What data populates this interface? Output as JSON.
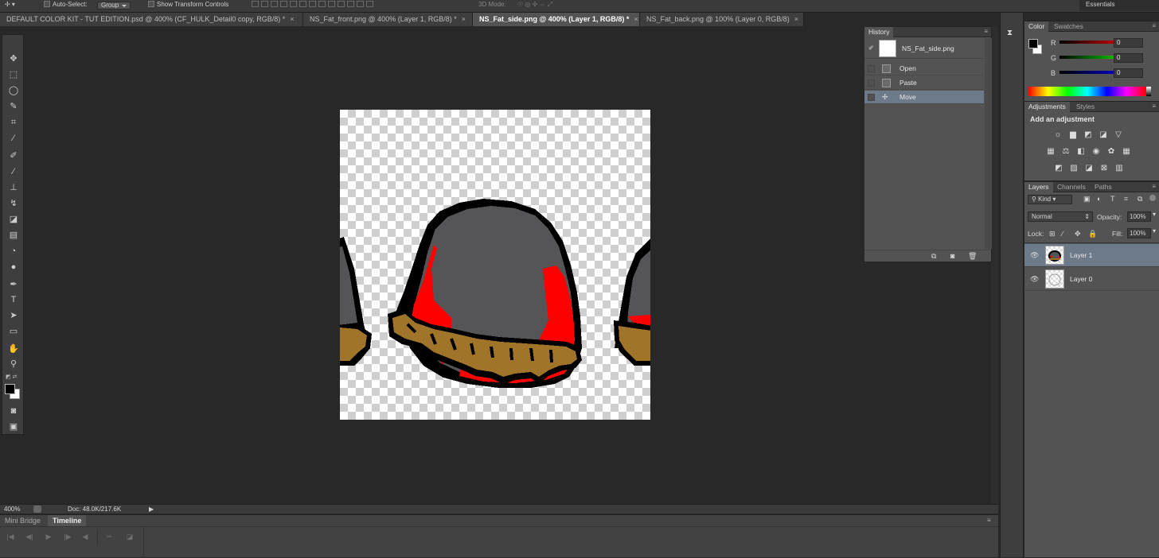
{
  "options_bar": {
    "auto_select_label": "Auto-Select:",
    "auto_select_value": "Group",
    "show_transform_label": "Show Transform Controls",
    "mode_3d_label": "3D Mode:",
    "workspace": "Essentials"
  },
  "tabs": [
    {
      "label": "DEFAULT COLOR KIT - TUT EDITION.psd @ 400% (CF_HULK_Detail0 copy, RGB/8) *",
      "close": "×"
    },
    {
      "label": "NS_Fat_front.png @ 400% (Layer 1, RGB/8) *",
      "close": "×"
    },
    {
      "label": "NS_Fat_side.png @ 400% (Layer 1, RGB/8) *",
      "close": "×"
    },
    {
      "label": "NS_Fat_back.png @ 100% (Layer 0, RGB/8)",
      "close": "×"
    }
  ],
  "status": {
    "zoom": "400%",
    "doc": "Doc: 48.0K/217.6K"
  },
  "bottom_panel": {
    "tabs": [
      "Mini Bridge",
      "Timeline"
    ]
  },
  "history": {
    "title": "History",
    "snapshot": "NS_Fat_side.png",
    "items": [
      "Open",
      "Paste",
      "Move"
    ]
  },
  "color_panel": {
    "tabs": [
      "Color",
      "Swatches"
    ],
    "channels": [
      {
        "label": "R",
        "value": "0"
      },
      {
        "label": "G",
        "value": "0"
      },
      {
        "label": "B",
        "value": "0"
      }
    ]
  },
  "adjustments_panel": {
    "tabs": [
      "Adjustments",
      "Styles"
    ],
    "heading": "Add an adjustment"
  },
  "layers_panel": {
    "tabs": [
      "Layers",
      "Channels",
      "Paths"
    ],
    "filter": "Kind",
    "blend_mode": "Normal",
    "opacity_label": "Opacity:",
    "opacity": "100%",
    "lock_label": "Lock:",
    "fill_label": "Fill:",
    "fill": "100%",
    "layers": [
      {
        "name": "Layer 1"
      },
      {
        "name": "Layer 0"
      }
    ]
  },
  "icons": {
    "tools": [
      "move-icon",
      "marquee-icon",
      "lasso-icon",
      "quick-select-icon",
      "crop-icon",
      "eyedropper-icon",
      "healing-brush-icon",
      "brush-icon",
      "clone-stamp-icon",
      "history-brush-icon",
      "eraser-icon",
      "gradient-icon",
      "blur-icon",
      "dodge-icon",
      "pen-icon",
      "type-icon",
      "path-select-icon",
      "shape-icon",
      "hand-icon",
      "zoom-icon"
    ]
  },
  "colors": {
    "foreground": "#000000",
    "background": "#ffffff",
    "layer_selected": "#6d7a8a"
  }
}
